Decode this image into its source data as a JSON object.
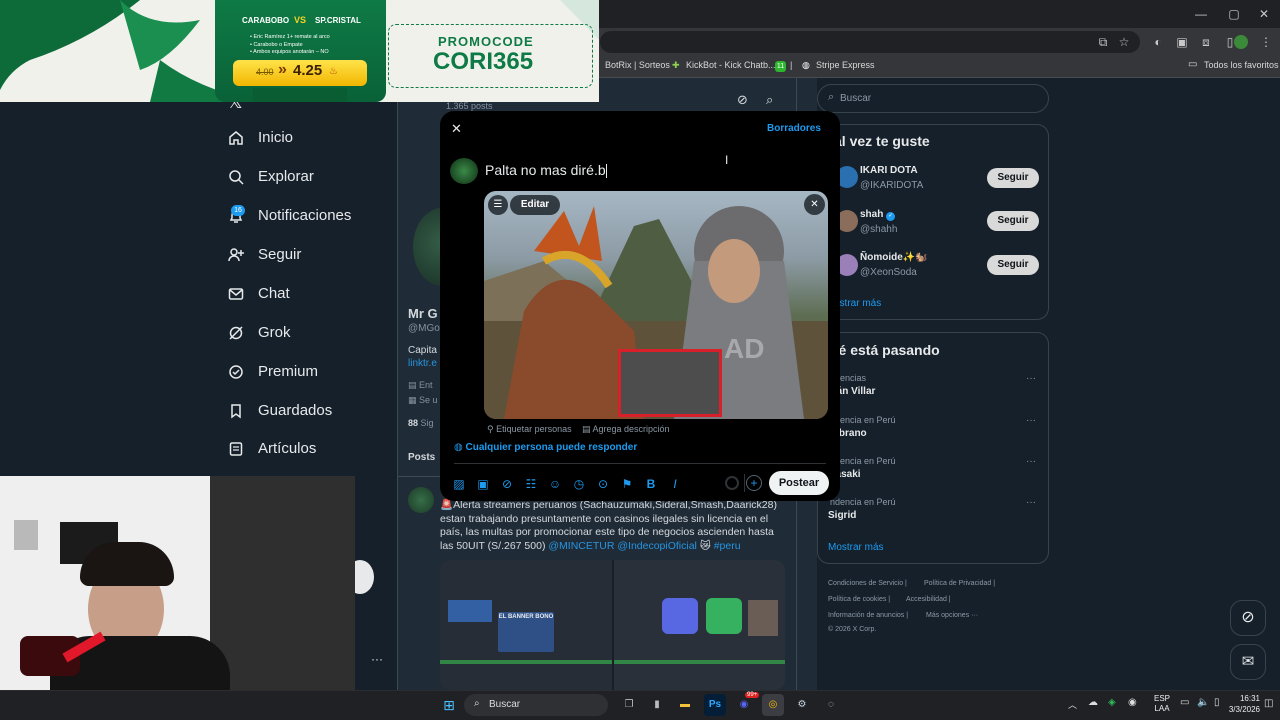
{
  "ad": {
    "team_home": "CARABOBO",
    "vs": "VS",
    "team_away": "SP.CRISTAL",
    "bullets": [
      "• Eric Ramírez 1+ remate al arco",
      "• Carabobo o Empate",
      "• Ambos equipos anotarán – NO"
    ],
    "old_odds": "4.00",
    "arrows": "»",
    "new_odds": "4.25",
    "promo_label": "PROMOCODE",
    "promo_code": "CORI365"
  },
  "browser": {
    "bookmarks": [
      "BotRix | Sorteos",
      "KickBot - Kick Chatb...",
      "11",
      "|",
      "Stripe Express"
    ],
    "all_favorites": "Todos los favoritos"
  },
  "sidebar": {
    "items": [
      {
        "label": "Inicio",
        "icon": "home-icon"
      },
      {
        "label": "Explorar",
        "icon": "search-icon"
      },
      {
        "label": "Notificaciones",
        "icon": "bell-icon",
        "badge": "16"
      },
      {
        "label": "Seguir",
        "icon": "add-user-icon"
      },
      {
        "label": "Chat",
        "icon": "mail-icon"
      },
      {
        "label": "Grok",
        "icon": "grok-icon"
      },
      {
        "label": "Premium",
        "icon": "verified-icon"
      },
      {
        "label": "Guardados",
        "icon": "bookmark-icon"
      },
      {
        "label": "Artículos",
        "icon": "article-icon"
      }
    ]
  },
  "profile": {
    "posts_count": "1.365 posts",
    "name": "Mr G",
    "handle": "@MGo",
    "bio": "Capita",
    "link": "linktr.e",
    "entity": "Ent",
    "joined": "Se u",
    "following_count": "88",
    "following_label": "Sig",
    "tab_posts": "Posts"
  },
  "post": {
    "text": "🚨Alerta streamers peruanos (Sachauzumaki,Sideral,Smash,Daarick28) estan trabajando presuntamente con casinos ilegales sin licencia en el país, las multas por promocionar este tipo de negocios ascienden hasta las 50UIT (S/.267 500)",
    "mentions": "@MINCETUR @IndecopiOficial",
    "hashtag": "#peru",
    "thumb_text": "EL BANNER BONO"
  },
  "composer": {
    "drafts": "Borradores",
    "text": "Palta no mas diré.b",
    "edit": "Editar",
    "tag_people": "Etiquetar personas",
    "add_description": "Agrega descripción",
    "reply_setting": "Cualquier persona puede responder",
    "post_button": "Postear",
    "image_watermark": "AD"
  },
  "right": {
    "search_placeholder": "Buscar",
    "suggest_title": "al vez te guste",
    "suggestions": [
      {
        "name": "IKARI DOTA",
        "handle": "@IKARIDOTA",
        "button": "Seguir"
      },
      {
        "name": "shah",
        "handle": "@shahh",
        "button": "Seguir"
      },
      {
        "name": "Ñomoide✨🐿️",
        "handle": "@XeonSoda",
        "button": "Seguir"
      }
    ],
    "show_more_1": "ostrar más",
    "trends_title": "ué está pasando",
    "trends": [
      {
        "context": "ndencias",
        "name": "rián Villar"
      },
      {
        "context": "ndencia en Perú",
        "name": "mbrano"
      },
      {
        "context": "ndencia en Perú",
        "name": "kasaki"
      },
      {
        "context": "ndencia en Perú",
        "name": "Sigrid"
      }
    ],
    "show_more_2": "Mostrar más",
    "footer": [
      "Condiciones de Servicio |",
      "Política de Privacidad |",
      "Política de cookies |",
      "Accesibilidad |",
      "Información de anuncios |",
      "Más opciones ···",
      "© 2026 X Corp."
    ]
  },
  "taskbar": {
    "search": "Buscar",
    "lang_1": "ESP",
    "lang_2": "LAA",
    "time": "16:31",
    "date": "3/3/2026",
    "badge": "99+"
  }
}
